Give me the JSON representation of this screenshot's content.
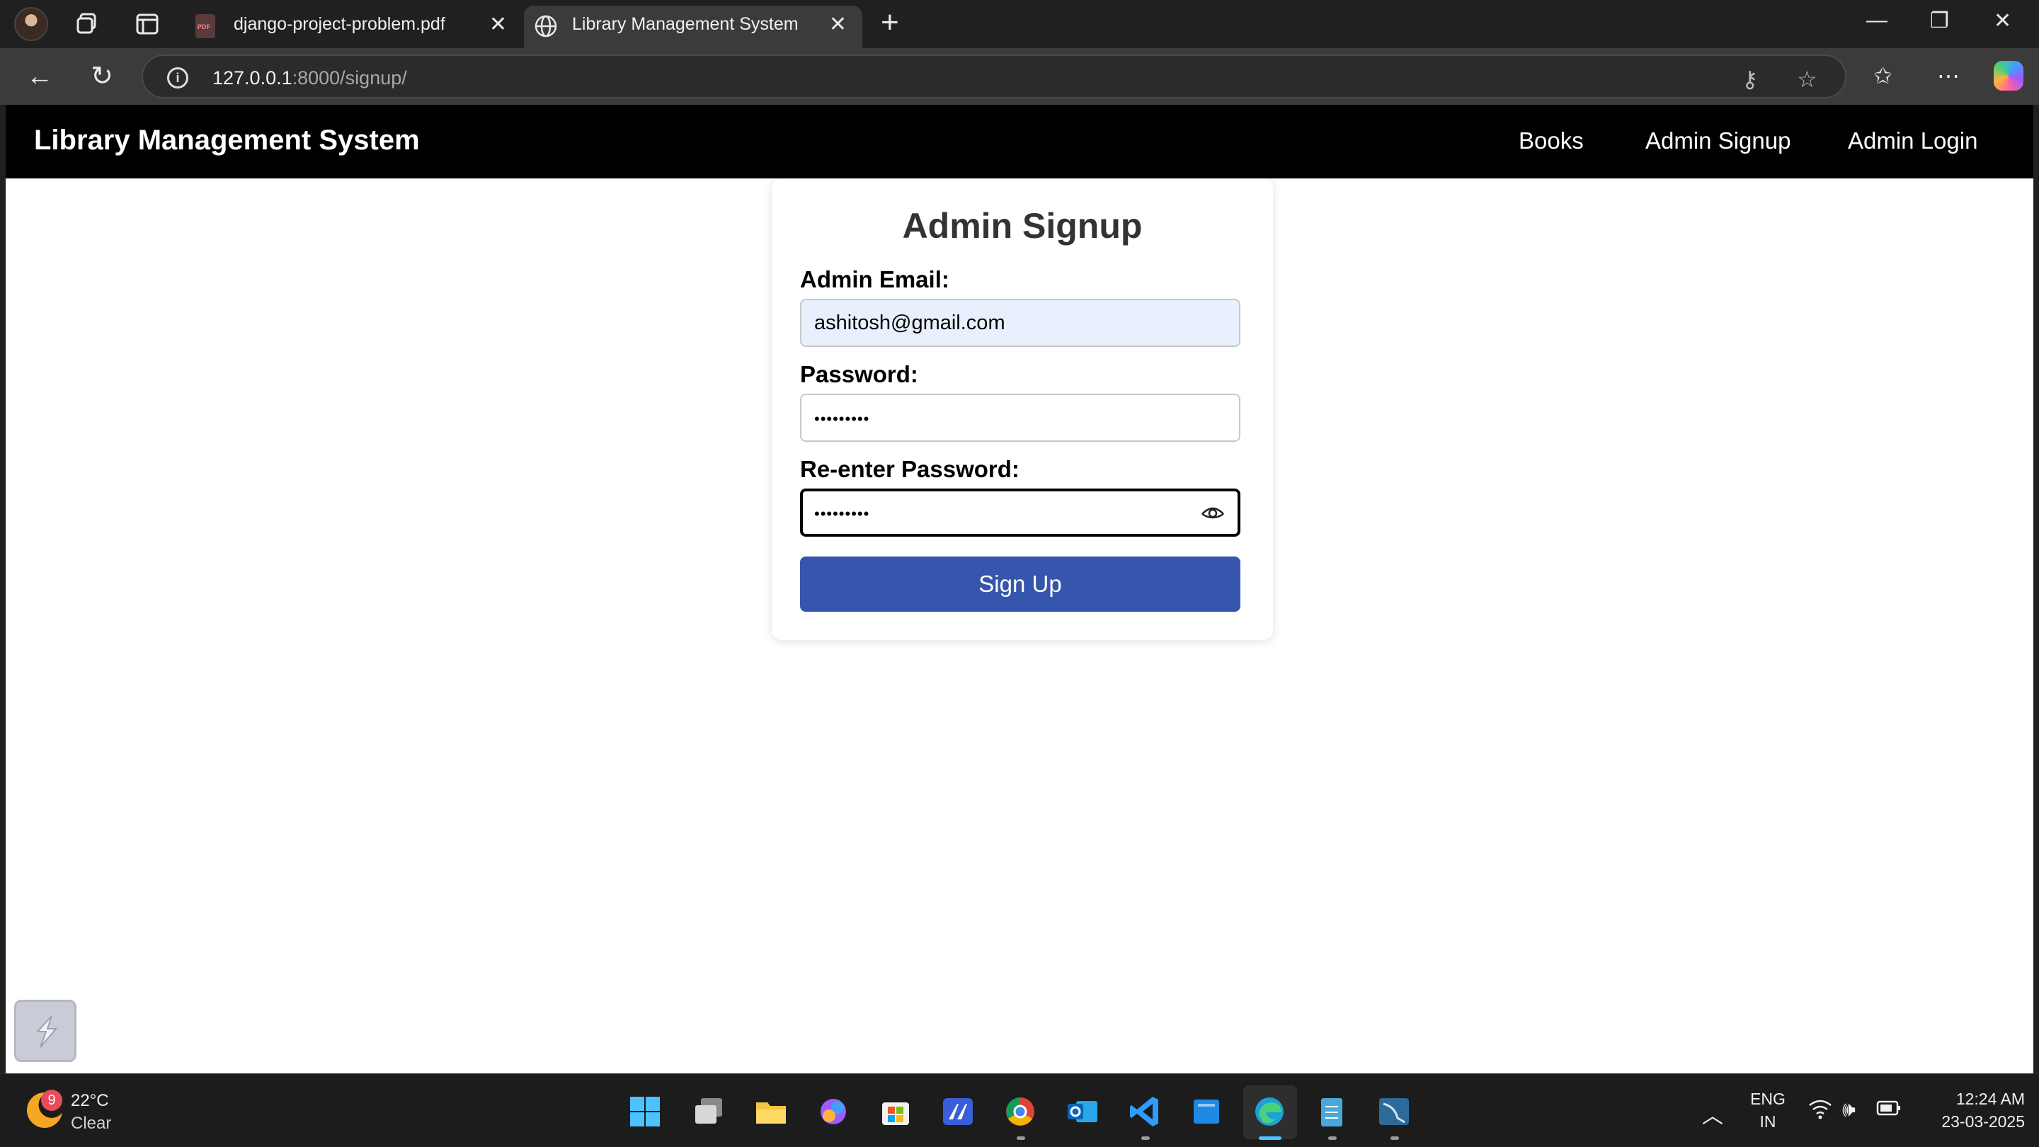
{
  "browser": {
    "tabs": [
      {
        "title": "django-project-problem.pdf",
        "active": false
      },
      {
        "title": "Library Management System",
        "active": true
      }
    ],
    "url_host": "127.0.0.1",
    "url_path": ":8000/signup/"
  },
  "navbar": {
    "brand": "Library Management System",
    "links": [
      "Books",
      "Admin Signup",
      "Admin Login"
    ]
  },
  "form": {
    "title": "Admin Signup",
    "email_label": "Admin Email:",
    "email_value": "ashitosh@gmail.com",
    "password_label": "Password:",
    "password_value": "•••••••••",
    "reenter_label": "Re-enter Password:",
    "reenter_value": "•••••••••",
    "submit_label": "Sign Up"
  },
  "taskbar": {
    "weather_badge": "9",
    "weather_temp": "22°C",
    "weather_desc": "Clear",
    "lang_top": "ENG",
    "lang_bottom": "IN",
    "time": "12:24 AM",
    "date": "23-03-2025"
  },
  "colors": {
    "accent_button": "#3656ad",
    "navbar_bg": "#000000",
    "email_autofill_bg": "#e8f0fe"
  }
}
